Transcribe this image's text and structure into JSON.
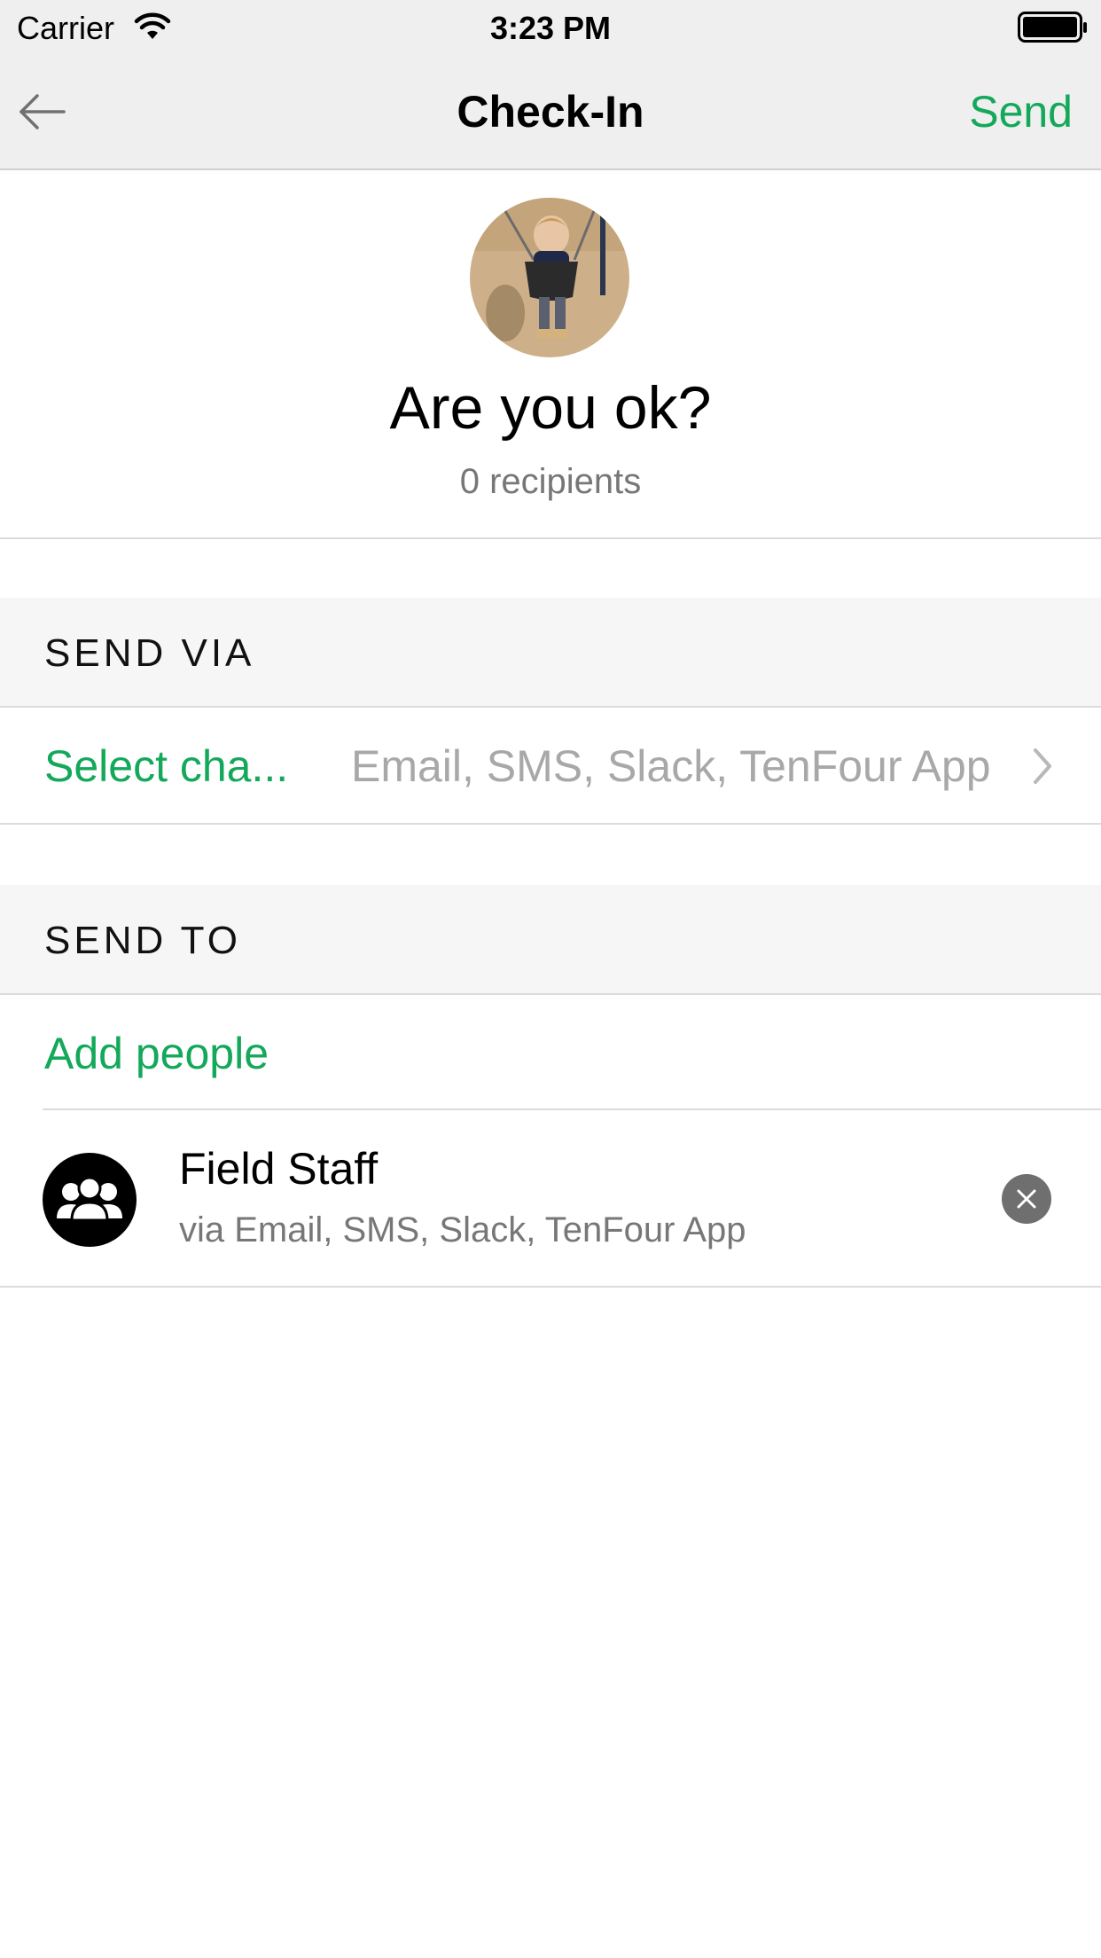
{
  "status_bar": {
    "carrier": "Carrier",
    "time": "3:23 PM",
    "icons": [
      "wifi-icon",
      "battery-icon"
    ]
  },
  "nav": {
    "back_icon": "arrow-left-icon",
    "title": "Check-In",
    "send_label": "Send"
  },
  "header": {
    "avatar": "child-on-swing-photo",
    "title": "Are you ok?",
    "recipients": "0 recipients"
  },
  "send_via": {
    "heading": "SEND VIA",
    "label": "Select cha...",
    "value": "Email, SMS, Slack, TenFour App",
    "chevron_icon": "chevron-right-icon"
  },
  "send_to": {
    "heading": "SEND TO",
    "add_label": "Add people",
    "groups": [
      {
        "icon": "group-people-icon",
        "name": "Field Staff",
        "channels": "via Email, SMS, Slack, TenFour App",
        "remove_icon": "close-icon"
      }
    ]
  },
  "colors": {
    "accent": "#13a85a",
    "bar_background": "#efefef",
    "section_background": "#f6f6f6",
    "secondary_text": "#777777",
    "placeholder_text": "#a8a8a8"
  }
}
